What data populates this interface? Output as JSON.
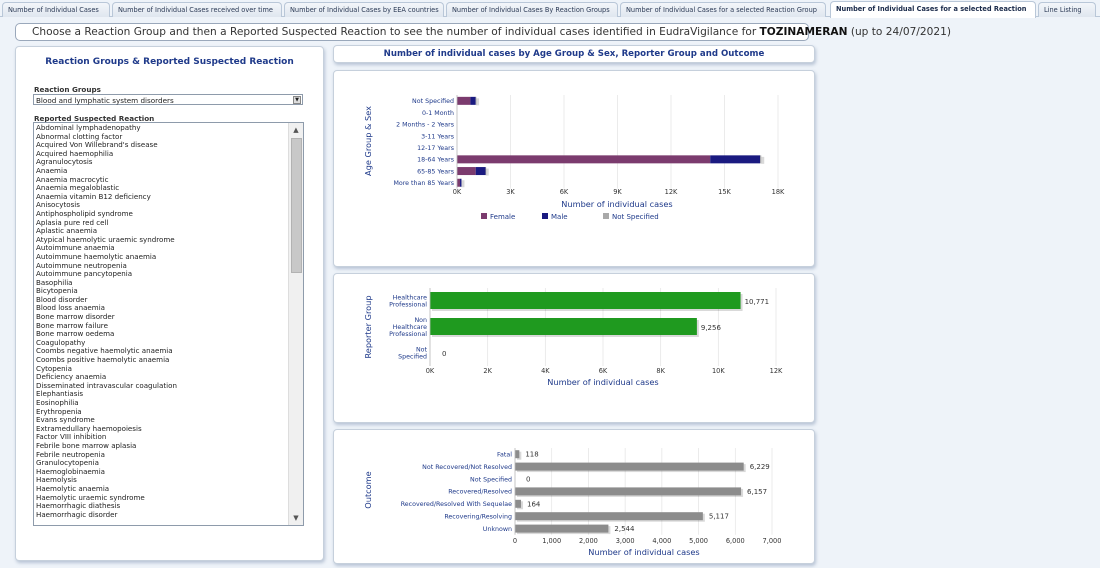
{
  "tabs": [
    {
      "label": "Number of Individual Cases",
      "active": false
    },
    {
      "label": "Number of Individual Cases received over time",
      "active": false
    },
    {
      "label": "Number of Individual Cases by EEA countries",
      "active": false
    },
    {
      "label": "Number of Individual Cases By Reaction Groups",
      "active": false
    },
    {
      "label": "Number of Individual Cases for a selected Reaction Group",
      "active": false
    },
    {
      "label": "Number of Individual Cases for a selected Reaction",
      "active": true
    },
    {
      "label": "Line Listing",
      "active": false
    }
  ],
  "prompt": {
    "text": "Choose a Reaction Group and then a Reported Suspected Reaction to see the number of individual cases identified in EudraVigilance for ",
    "product": "TOZINAMERAN",
    "suffix": " (up to 24/07/2021)"
  },
  "left": {
    "title": "Reaction Groups & Reported Suspected Reaction",
    "groups_label": "Reaction Groups",
    "selected_group": "Blood and lymphatic system disorders",
    "reactions_label": "Reported Suspected Reaction",
    "reactions": [
      "Abdominal lymphadenopathy",
      "Abnormal clotting factor",
      "Acquired Von Willebrand's disease",
      "Acquired haemophilia",
      "Agranulocytosis",
      "Anaemia",
      "Anaemia macrocytic",
      "Anaemia megaloblastic",
      "Anaemia vitamin B12 deficiency",
      "Anisocytosis",
      "Antiphospholipid syndrome",
      "Aplasia pure red cell",
      "Aplastic anaemia",
      "Atypical haemolytic uraemic syndrome",
      "Autoimmune anaemia",
      "Autoimmune haemolytic anaemia",
      "Autoimmune neutropenia",
      "Autoimmune pancytopenia",
      "Basophilia",
      "Bicytopenia",
      "Blood disorder",
      "Blood loss anaemia",
      "Bone marrow disorder",
      "Bone marrow failure",
      "Bone marrow oedema",
      "Coagulopathy",
      "Coombs negative haemolytic anaemia",
      "Coombs positive haemolytic anaemia",
      "Cytopenia",
      "Deficiency anaemia",
      "Disseminated intravascular coagulation",
      "Elephantiasis",
      "Eosinophilia",
      "Erythropenia",
      "Evans syndrome",
      "Extramedullary haemopoiesis",
      "Factor VIII inhibition",
      "Febrile bone marrow aplasia",
      "Febrile neutropenia",
      "Granulocytopenia",
      "Haemoglobinaemia",
      "Haemolysis",
      "Haemolytic anaemia",
      "Haemolytic uraemic syndrome",
      "Haemorrhagic diathesis",
      "Haemorrhagic disorder"
    ]
  },
  "main_title": "Number of individual cases by Age Group & Sex, Reporter Group and Outcome",
  "colors": {
    "female": "#7b3b6e",
    "male": "#1a1a80",
    "not_specified": "#a9a9a9",
    "reporter": "#1f9a1f",
    "outcome": "#8c8c8c",
    "label_blue": "#1f3a8a"
  },
  "chart_data": [
    {
      "type": "bar",
      "orientation": "horizontal",
      "stacked": true,
      "ylabel": "Age Group & Sex",
      "xlabel": "Number of individual cases",
      "categories": [
        "Not Specified",
        "0-1 Month",
        "2 Months - 2 Years",
        "3-11 Years",
        "12-17 Years",
        "18-64 Years",
        "65-85 Years",
        "More than 85 Years"
      ],
      "series": [
        {
          "name": "Female",
          "values": [
            750,
            0,
            0,
            0,
            0,
            14200,
            1050,
            170
          ]
        },
        {
          "name": "Male",
          "values": [
            300,
            0,
            0,
            0,
            0,
            2800,
            550,
            80
          ]
        },
        {
          "name": "Not Specified",
          "values": [
            20,
            0,
            0,
            0,
            0,
            60,
            10,
            0
          ]
        }
      ],
      "xlim": [
        0,
        18000
      ],
      "xticks": [
        "0K",
        "3K",
        "6K",
        "9K",
        "12K",
        "15K",
        "18K"
      ],
      "legend_position": "bottom"
    },
    {
      "type": "bar",
      "orientation": "horizontal",
      "ylabel": "Reporter Group",
      "xlabel": "Number of individual cases",
      "categories": [
        "Healthcare Professional",
        "Non Healthcare Professional",
        "Not Specified"
      ],
      "values": [
        10771,
        9256,
        0
      ],
      "value_labels": [
        "10,771",
        "9,256",
        "0"
      ],
      "xlim": [
        0,
        12000
      ],
      "xticks": [
        "0K",
        "2K",
        "4K",
        "6K",
        "8K",
        "10K",
        "12K"
      ]
    },
    {
      "type": "bar",
      "orientation": "horizontal",
      "ylabel": "Outcome",
      "xlabel": "Number of individual cases",
      "categories": [
        "Fatal",
        "Not Recovered/Not Resolved",
        "Not Specified",
        "Recovered/Resolved",
        "Recovered/Resolved With Sequelae",
        "Recovering/Resolving",
        "Unknown"
      ],
      "values": [
        118,
        6229,
        0,
        6157,
        164,
        5117,
        2544
      ],
      "value_labels": [
        "118",
        "6,229",
        "0",
        "6,157",
        "164",
        "5,117",
        "2,544"
      ],
      "xlim": [
        0,
        7000
      ],
      "xticks": [
        "0",
        "1,000",
        "2,000",
        "3,000",
        "4,000",
        "5,000",
        "6,000",
        "7,000"
      ]
    }
  ]
}
